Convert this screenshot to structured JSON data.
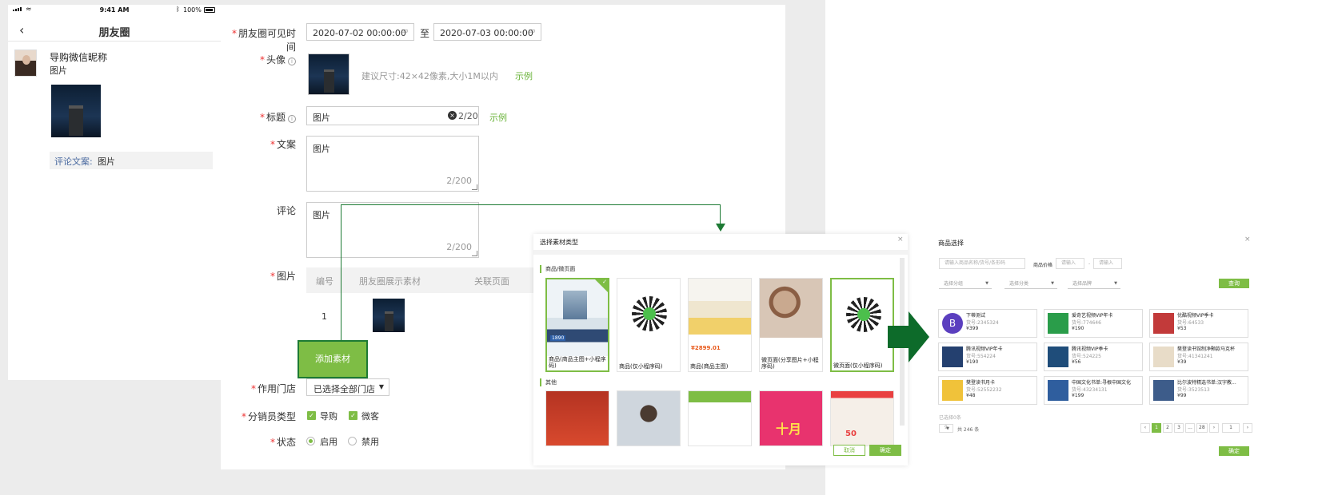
{
  "phone": {
    "status": {
      "time": "9:41 AM",
      "battery": "100%"
    },
    "nav_title": "朋友圈",
    "post": {
      "nickname": "导购微信昵称",
      "text": "图片",
      "comment_label": "评论文案:",
      "comment_value": "图片"
    }
  },
  "form": {
    "visible_time": {
      "label": "朋友圈可见时间",
      "start": "2020-07-02 00:00:00",
      "separator": "至",
      "end": "2020-07-03 00:00:00"
    },
    "avatar": {
      "label": "头像",
      "hint": "建议尺寸:42×42像素,大小1M以内",
      "example": "示例"
    },
    "title": {
      "label": "标题",
      "value": "图片",
      "counter": "2/20",
      "example": "示例"
    },
    "copy": {
      "label": "文案",
      "value": "图片",
      "counter": "2/200"
    },
    "comment": {
      "label": "评论",
      "value": "图片",
      "counter": "2/200"
    },
    "images": {
      "label": "图片",
      "columns": [
        "编号",
        "朋友圈展示素材",
        "关联页面"
      ],
      "rows": [
        {
          "no": "1"
        }
      ],
      "add_button": "添加素材"
    },
    "store": {
      "label": "作用门店",
      "value": "已选择全部门店"
    },
    "seller_type": {
      "label": "分销员类型",
      "options": [
        {
          "label": "导购",
          "checked": true
        },
        {
          "label": "微客",
          "checked": true
        }
      ]
    },
    "status": {
      "label": "状态",
      "options": [
        {
          "label": "启用",
          "selected": true
        },
        {
          "label": "禁用",
          "selected": false
        }
      ]
    }
  },
  "material_dialog": {
    "title": "选择素材类型",
    "section1": "商品/微页面",
    "section2": "其他",
    "cards": [
      {
        "caption": "商品(商品主图+小程序码)",
        "selected": true,
        "price": "1890"
      },
      {
        "caption": "商品(仅小程序码)",
        "selected": false
      },
      {
        "caption": "商品(商品主图)",
        "selected": false,
        "price": "¥2899.01"
      },
      {
        "caption": "微页面(分享图片+小程序码)",
        "selected": false
      },
      {
        "caption": "微页面(仅小程序码)",
        "selected": true
      }
    ],
    "poster_text": "十月",
    "poster_sale": "50",
    "cancel": "取消",
    "confirm": "确定"
  },
  "product_dialog": {
    "title": "商品选择",
    "search_placeholder": "请输入商品名称/货号/条形码",
    "price_label": "商品价格",
    "price_min_placeholder": "请输入",
    "price_sep": "-",
    "price_max_placeholder": "请输入",
    "filters": [
      "选择分组",
      "选择分类",
      "选择品牌"
    ],
    "query": "查询",
    "products": [
      {
        "name": "下蒂测试",
        "code": "货号:2345324",
        "price": "¥399",
        "color": "#5b3fbf",
        "letter": "B"
      },
      {
        "name": "爱奇艺视频VIP年卡",
        "code": "货号:774646",
        "price": "¥190",
        "color": "#2a9d4a"
      },
      {
        "name": "优酷视频VIP季卡",
        "code": "货号:64533",
        "price": "¥53",
        "color": "#c23a3a"
      },
      {
        "name": "腾讯视频VIP年卡",
        "code": "货号:554224",
        "price": "¥190",
        "color": "#24406f"
      },
      {
        "name": "腾讯视频VIP季卡",
        "code": "货号:524225",
        "price": "¥56",
        "color": "#1f4d7a"
      },
      {
        "name": "樊登读书馆制净颗款马克杯",
        "code": "货号:41341241",
        "price": "¥39",
        "color": "#e8dcc8"
      },
      {
        "name": "樊登读书月卡",
        "code": "货号:52552232",
        "price": "¥48",
        "color": "#f0c23a"
      },
      {
        "name": "中国文化书单:寻根中国文化",
        "code": "货号:43234131",
        "price": "¥199",
        "color": "#2f5e9e"
      },
      {
        "name": "比尔波特精选书单:汉字教...",
        "code": "货号:3523513",
        "price": "¥99",
        "color": "#3d5c8a"
      }
    ],
    "selected_count": "已选择0条",
    "page_size": "9",
    "total": "共 246 条",
    "pages": [
      "1",
      "2",
      "3",
      "...",
      "28"
    ],
    "jump_value": "1",
    "confirm": "确定"
  }
}
